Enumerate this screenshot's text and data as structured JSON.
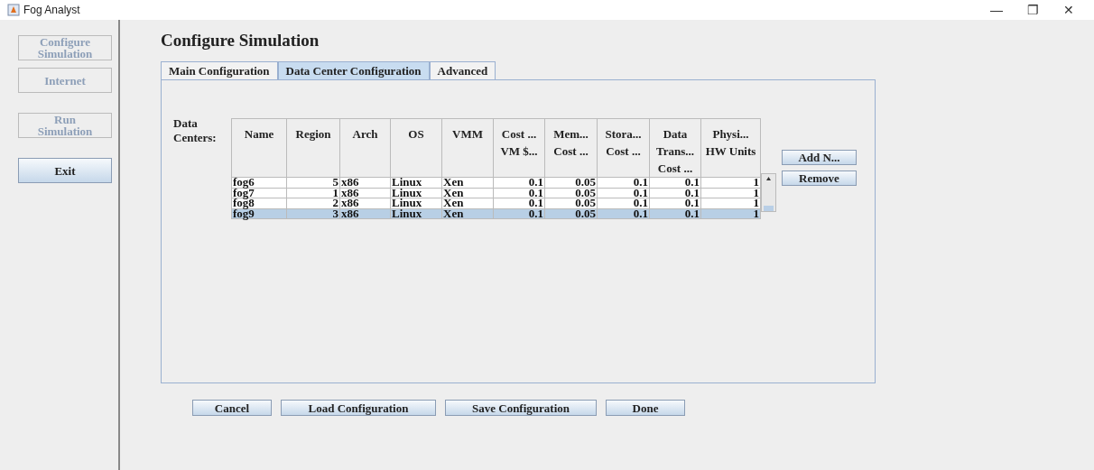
{
  "window": {
    "title": "Fog Analyst",
    "controls": [
      "—",
      "❐",
      "✕"
    ]
  },
  "sidebar": {
    "items": [
      {
        "label": "Configure Simulation",
        "disabled": true
      },
      {
        "label": "Internet",
        "disabled": true
      },
      {
        "label": "Run Simulation",
        "disabled": true
      },
      {
        "label": "Exit",
        "disabled": false
      }
    ]
  },
  "heading": "Configure Simulation",
  "tabs": [
    {
      "label": "Main Configuration",
      "selected": false
    },
    {
      "label": "Data Center Configuration",
      "selected": true
    },
    {
      "label": "Advanced",
      "selected": false
    }
  ],
  "data_centers_label": "Data Centers:",
  "table": {
    "columns": [
      {
        "label": "Name",
        "kind": "text"
      },
      {
        "label": "Region",
        "kind": "number"
      },
      {
        "label": "Arch",
        "kind": "text"
      },
      {
        "label": "OS",
        "kind": "text"
      },
      {
        "label": "VMM",
        "kind": "text"
      },
      {
        "label": "Cost ... VM $...",
        "kind": "number"
      },
      {
        "label": "Mem... Cost ...",
        "kind": "number"
      },
      {
        "label": "Stora... Cost ...",
        "kind": "number"
      },
      {
        "label": "Data Trans... Cost ...",
        "kind": "number"
      },
      {
        "label": "Physi... HW Units",
        "kind": "number"
      }
    ],
    "rows": [
      {
        "cells": [
          "fog6",
          "5",
          "x86",
          "Linux",
          "Xen",
          "0.1",
          "0.05",
          "0.1",
          "0.1",
          "1"
        ],
        "selected": false
      },
      {
        "cells": [
          "fog7",
          "1",
          "x86",
          "Linux",
          "Xen",
          "0.1",
          "0.05",
          "0.1",
          "0.1",
          "1"
        ],
        "selected": false
      },
      {
        "cells": [
          "fog8",
          "2",
          "x86",
          "Linux",
          "Xen",
          "0.1",
          "0.05",
          "0.1",
          "0.1",
          "1"
        ],
        "selected": false
      },
      {
        "cells": [
          "fog9",
          "3",
          "x86",
          "Linux",
          "Xen",
          "0.1",
          "0.05",
          "0.1",
          "0.1",
          "1"
        ],
        "selected": true
      }
    ]
  },
  "side_buttons": [
    "Add N...",
    "Remove"
  ],
  "buttons": [
    "Cancel",
    "Load Configuration",
    "Save Configuration",
    "Done"
  ]
}
